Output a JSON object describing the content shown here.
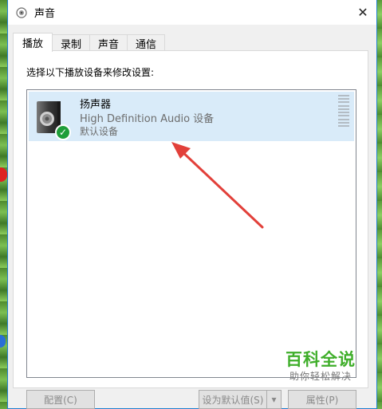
{
  "window": {
    "title": "声音",
    "close_glyph": "✕"
  },
  "tabs": [
    {
      "label": "播放",
      "active": true
    },
    {
      "label": "录制",
      "active": false
    },
    {
      "label": "声音",
      "active": false
    },
    {
      "label": "通信",
      "active": false
    }
  ],
  "panel": {
    "instruction": "选择以下播放设备来修改设置:"
  },
  "device": {
    "name": "扬声器",
    "description": "High Definition Audio 设备",
    "status": "默认设备",
    "icon": "speaker-icon",
    "badge_icon": "check-icon",
    "badge_glyph": "✓",
    "badge_color": "#1f9e3a",
    "selected_bg": "#d9ebf9"
  },
  "buttons": {
    "configure": "配置(C)",
    "set_default": "设为默认值(S)",
    "dropdown_glyph": "▾",
    "properties": "属性(P)"
  },
  "annotation": {
    "arrow_color": "#e2403a"
  },
  "watermark": {
    "title": "百科全说",
    "subtitle": "助你轻松解决"
  }
}
